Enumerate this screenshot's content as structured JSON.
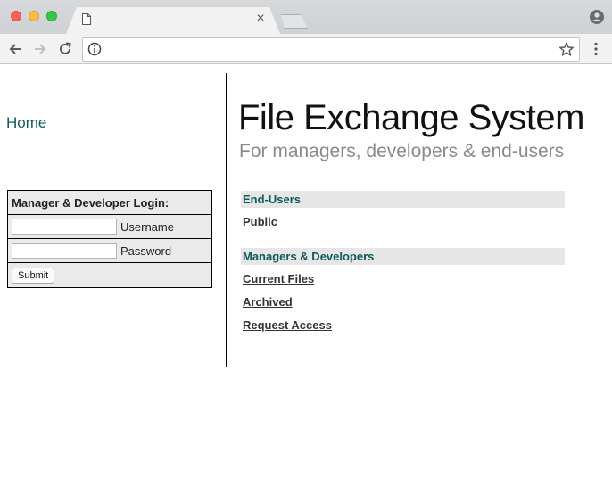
{
  "browser": {
    "tab_title": "",
    "tab_close_glyph": "×",
    "address": "",
    "colors": {
      "close": "#fc605b",
      "minimize": "#fdbc40",
      "maximize": "#34c84a"
    },
    "icons": [
      "page-icon",
      "back-arrow-icon",
      "forward-arrow-icon",
      "reload-icon",
      "info-icon",
      "star-icon",
      "menu-dots-icon",
      "profile-icon"
    ]
  },
  "sidebar": {
    "home_label": "Home",
    "login": {
      "header": "Manager & Developer Login:",
      "username_label": "Username",
      "username_value": "",
      "password_label": "Password",
      "password_value": "",
      "submit_label": "Submit"
    }
  },
  "main": {
    "title": "File Exchange System",
    "subtitle": "For managers, developers & end-users",
    "sections": [
      {
        "heading": "End-Users",
        "links": [
          "Public"
        ]
      },
      {
        "heading": "Managers & Developers",
        "links": [
          "Current Files",
          "Archived",
          "Request Access"
        ]
      }
    ],
    "accent_color": "#0f5a5a"
  }
}
